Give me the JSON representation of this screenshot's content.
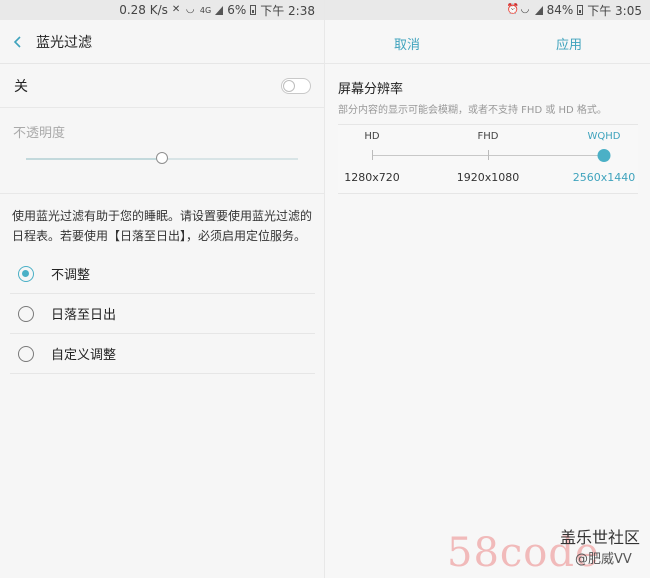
{
  "left": {
    "statusbar": {
      "speed": "0.28 K/s",
      "net": "4G",
      "battery": "6%",
      "time": "下午 2:38"
    },
    "appbar": {
      "title": "蓝光过滤"
    },
    "toggle": {
      "label": "关",
      "on": false
    },
    "opacity": {
      "label": "不透明度",
      "value": 0.5
    },
    "description": "使用蓝光过滤有助于您的睡眠。请设置要使用蓝光过滤的日程表。若要使用【日落至日出】，必须启用定位服务。",
    "schedule": [
      {
        "label": "不调整",
        "selected": true
      },
      {
        "label": "日落至日出",
        "selected": false
      },
      {
        "label": "自定义调整",
        "selected": false
      }
    ]
  },
  "right": {
    "statusbar": {
      "battery": "84%",
      "time": "下午 3:05"
    },
    "appbar": {
      "cancel_label": "取消",
      "apply_label": "应用"
    },
    "resolution": {
      "title": "屏幕分辨率",
      "subtitle": "部分内容的显示可能会模糊，或者不支持 FHD 或 HD 格式。",
      "options": [
        {
          "name": "HD",
          "size": "1280x720"
        },
        {
          "name": "FHD",
          "size": "1920x1080"
        },
        {
          "name": "WQHD",
          "size": "2560x1440"
        }
      ],
      "selected_index": 2
    }
  },
  "watermark": {
    "site": "58code",
    "community": "盖乐世社区",
    "user": "@肥威VV"
  },
  "colors": {
    "accent": "#4bb0c6",
    "link": "#3fa3bd"
  }
}
